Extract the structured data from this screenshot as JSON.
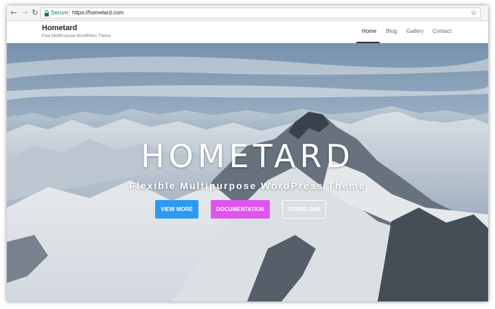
{
  "browser": {
    "secure_label": "Secure",
    "url": "https://hometard.com",
    "icons": [
      "back-icon",
      "forward-icon",
      "reload-icon",
      "lock-icon",
      "star-icon"
    ]
  },
  "site": {
    "title": "Hometard",
    "tagline": "Free MultiPurpose WordPress Theme"
  },
  "nav": {
    "items": [
      {
        "label": "Home",
        "active": true
      },
      {
        "label": "Blog",
        "active": false
      },
      {
        "label": "Gallery",
        "active": false
      },
      {
        "label": "Contact",
        "active": false
      }
    ]
  },
  "hero": {
    "title": "HOMETARD",
    "subtitle": "Flexible Multipurpose WordPress Theme",
    "buttons": {
      "view_more": "VIEW MORE",
      "documentation": "DOCUMENTATION",
      "download": "DOWNLOAD"
    }
  },
  "colors": {
    "view_more": "#2b9af3",
    "documentation": "#e053f0",
    "secure": "#0b8043"
  }
}
